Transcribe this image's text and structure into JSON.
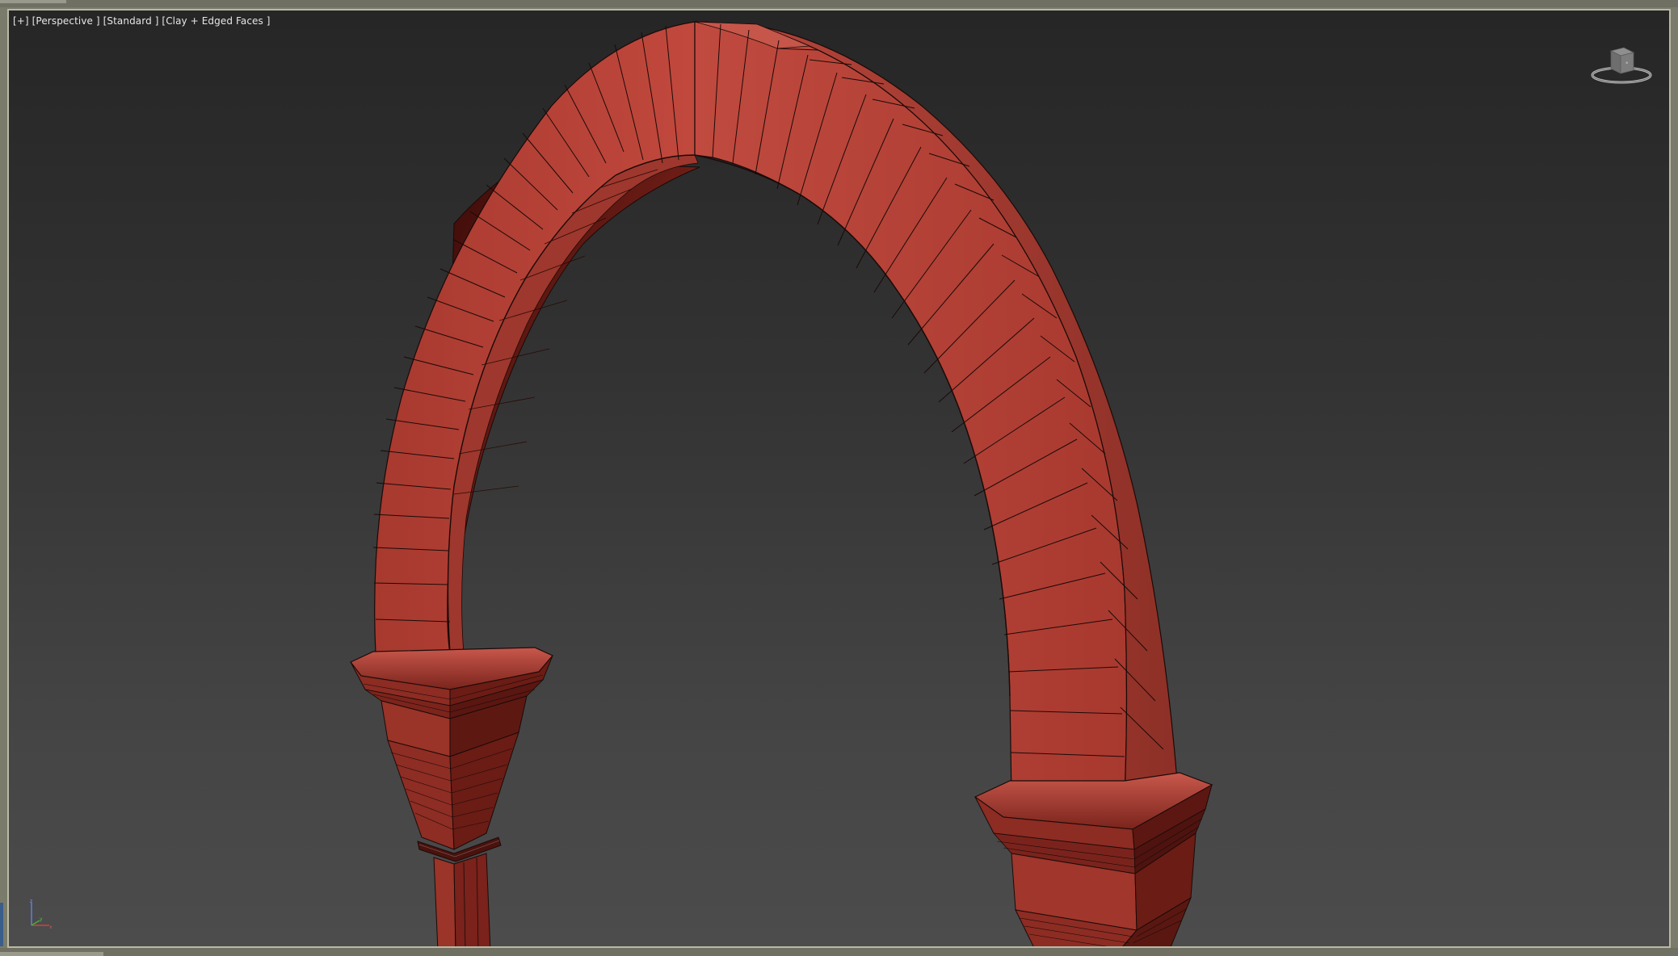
{
  "viewport": {
    "label": "[+] [Perspective ] [Standard ] [Clay + Edged Faces ]",
    "view": "Perspective",
    "shading": "Clay + Edged Faces",
    "mode": "Standard"
  },
  "scene": {
    "object": "pointed-arch",
    "colors": {
      "clay_face": "#b8463c",
      "clay_shadow": "#5c1712",
      "edge": "#1a0a08",
      "background_top": "#262626",
      "background_bottom": "#4c4c4c",
      "frame_border": "#b9b9a5"
    }
  },
  "icons": {
    "viewcube": "viewcube-icon",
    "axis": "axis-tripod-icon"
  }
}
